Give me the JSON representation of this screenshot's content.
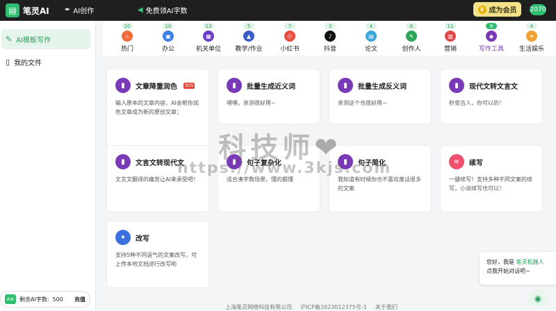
{
  "topbar": {
    "logo_text": "笔灵AI",
    "ai_create": "AI创作",
    "free_words": "免费领AI字数",
    "vip_button": "成为会员",
    "user_count": "2070"
  },
  "sidebar": {
    "items": [
      {
        "label": "AI模板写作",
        "icon": "pen-icon"
      },
      {
        "label": "我的文件",
        "icon": "file-icon"
      }
    ],
    "balance_label": "剩余AI字数:",
    "balance_value": "500",
    "recharge": "充值"
  },
  "categories": [
    {
      "label": "热门",
      "count": "20",
      "color": "#f06a3c",
      "glyph": "♨"
    },
    {
      "label": "办公",
      "count": "10",
      "color": "#3b7ee8",
      "glyph": "▣"
    },
    {
      "label": "机关单位",
      "count": "13",
      "color": "#6a3cc8",
      "glyph": "▦"
    },
    {
      "label": "教学/作业",
      "count": "5",
      "color": "#3b5ec8",
      "glyph": "▲"
    },
    {
      "label": "小红书",
      "count": "7",
      "color": "#e94a3c",
      "glyph": "red"
    },
    {
      "label": "抖音",
      "count": "3",
      "color": "#111111",
      "glyph": "♪"
    },
    {
      "label": "论文",
      "count": "4",
      "color": "#3aa7d8",
      "glyph": "▤"
    },
    {
      "label": "创作人",
      "count": "6",
      "color": "#2fa55c",
      "glyph": "✎"
    },
    {
      "label": "营销",
      "count": "11",
      "color": "#e04848",
      "glyph": "▥"
    },
    {
      "label": "写作工具",
      "count": "9",
      "color": "#7a3ab8",
      "glyph": "◆",
      "active": true
    },
    {
      "label": "生活娱乐",
      "count": "4",
      "color": "#f0a030",
      "glyph": "✦"
    }
  ],
  "cards": [
    {
      "title": "文章降重润色",
      "badge": "SOS",
      "desc": "输入原本的文章内容，AI会帮你润色文章成为新的原创文章；",
      "icon": "book-icon",
      "color": "#7a3ab8"
    },
    {
      "title": "批量生成近义词",
      "desc": "嘿嘿，亲测很好用~",
      "icon": "book-icon",
      "color": "#7a3ab8"
    },
    {
      "title": "批量生成反义词",
      "desc": "亲测这个也很好用~",
      "icon": "book-icon",
      "color": "#7a3ab8"
    },
    {
      "title": "现代文转文言文",
      "desc": "秒变古人，你可以的！",
      "icon": "book-icon",
      "color": "#7a3ab8"
    },
    {
      "title": "文言文转现代文",
      "desc": "文言文翻译的痛苦让AI来承受吧！",
      "icon": "book-icon",
      "color": "#7a3ab8"
    },
    {
      "title": "句子复杂化",
      "desc": "适合凑字数场景，懂的都懂",
      "icon": "book-icon",
      "color": "#7a3ab8"
    },
    {
      "title": "句子简化",
      "desc": "我知道有时候你也不喜欢废话很多的文案",
      "icon": "book-icon",
      "color": "#7a3ab8"
    },
    {
      "title": "续写",
      "desc": "一键续写！支持多种不同文案的续写，小说续写也可以！",
      "icon": "continue-icon",
      "color": "#f0506e"
    },
    {
      "title": "改写",
      "desc": "支持5种不同语气的文案改写，可上传本地文档进行改写哟",
      "icon": "magic-wand-icon",
      "color": "#3b6fe0"
    }
  ],
  "watermark": {
    "text": "科技师",
    "url": "https://www.3kjs.com"
  },
  "chat": {
    "greeting": "您好，我是",
    "bot_name": "笔灵机器人",
    "prompt": "点我开始对话吧~"
  },
  "footer": {
    "company": "上海笔灵网络科技有限公司",
    "icp": "沪ICP备2023012375号-1",
    "about": "关于我们"
  }
}
